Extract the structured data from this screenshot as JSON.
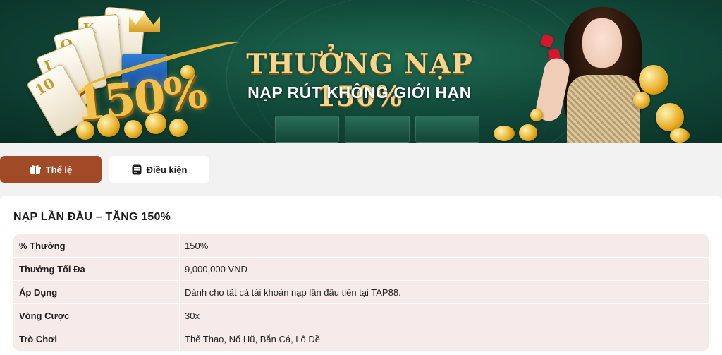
{
  "banner": {
    "headline": "THƯỞNG NẠP 150%",
    "subheadline": "NẠP RÚT KHÔNG GIỚI HẠN",
    "graphic_text": "150%",
    "card_letters": [
      "A",
      "K",
      "Q",
      "J",
      "10"
    ]
  },
  "tabs": [
    {
      "label": "Thể lệ",
      "icon": "gift-icon",
      "active": true
    },
    {
      "label": "Điều kiện",
      "icon": "document-icon",
      "active": false
    }
  ],
  "section": {
    "title": "NẠP LẦN ĐẦU – TẶNG 150%",
    "rows": [
      {
        "key": "% Thưởng",
        "value": "150%"
      },
      {
        "key": "Thưởng Tối Đa",
        "value": "9,000,000 VND"
      },
      {
        "key": "Áp Dụng",
        "value": "Dành cho tất cả tài khoản nạp lần đầu tiên tại TAP88."
      },
      {
        "key": "Vòng Cược",
        "value": "30x"
      },
      {
        "key": "Trò Chơi",
        "value": "Thể Thao, Nổ Hũ, Bắn Cá, Lô Đề"
      }
    ]
  },
  "colors": {
    "accent": "#a14a27",
    "banner_green": "#114a3a",
    "table_bg": "#f6ebe8",
    "gold": "#f6d58a"
  }
}
